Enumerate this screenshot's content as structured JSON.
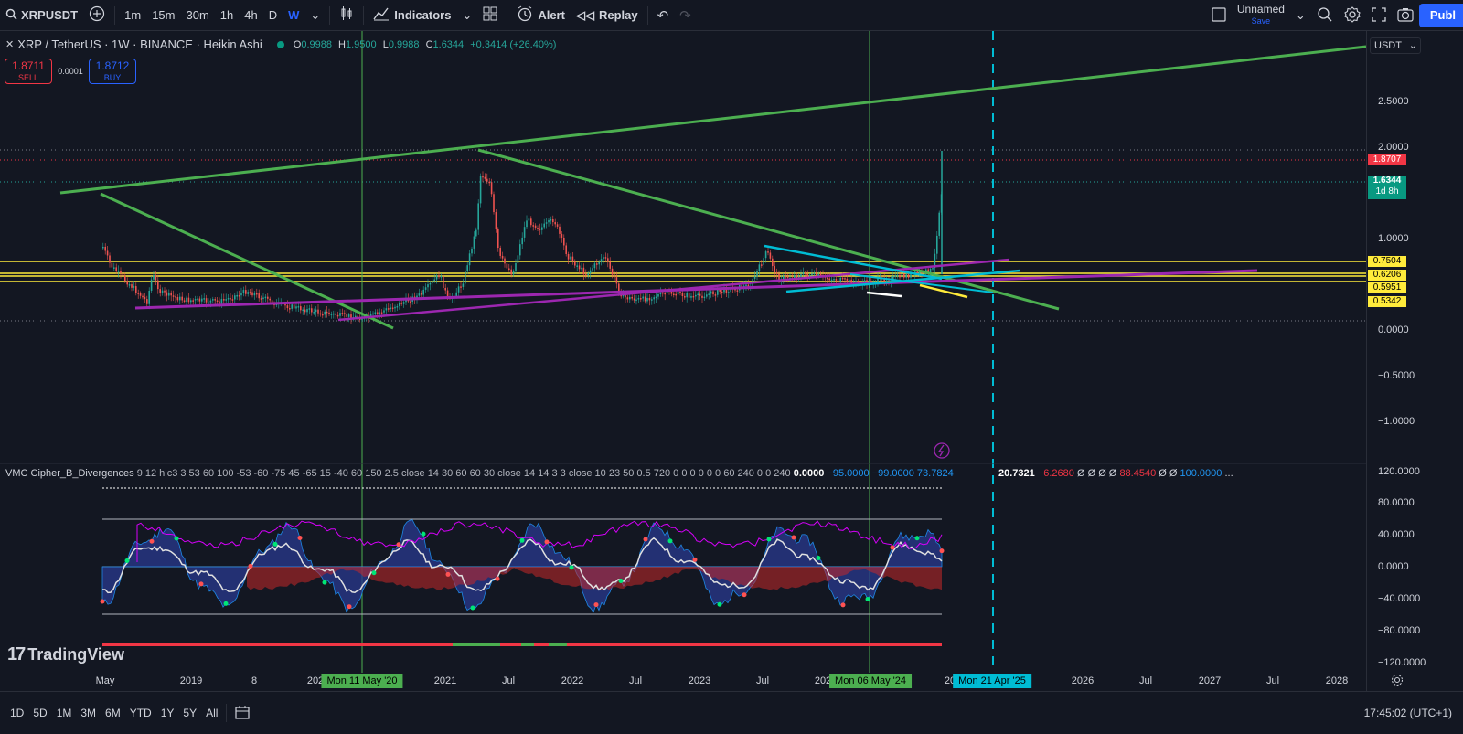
{
  "toolbar": {
    "symbol": "XRPUSDT",
    "intervals": [
      "1m",
      "15m",
      "30m",
      "1h",
      "4h",
      "D",
      "W"
    ],
    "active_interval": "W",
    "indicators_label": "Indicators",
    "alert_label": "Alert",
    "replay_label": "Replay",
    "layout_name": "Unnamed",
    "layout_save": "Save",
    "publish_label": "Publ"
  },
  "legend": {
    "title": "XRP / TetherUS · 1W · BINANCE · Heikin Ashi",
    "open_label": "O",
    "open": "0.9988",
    "high_label": "H",
    "high": "1.9500",
    "low_label": "L",
    "low": "0.9988",
    "close_label": "C",
    "close": "1.6344",
    "change": "+0.3414 (+26.40%)"
  },
  "trade": {
    "sell_price": "1.8711",
    "sell_label": "SELL",
    "spread": "0.0001",
    "buy_price": "1.8712",
    "buy_label": "BUY"
  },
  "indicator": {
    "name": "VMC Cipher_B_Divergences",
    "params": "9 12 hlc3 3 53 60 100 -53 -60 -75 45 -65 15 -40 60 150 2.5 close 14 30 60 60 30 close 14 14 3 3 close 10 23 50 0.5 720 0 0 0 0 0 0 60 240 0 0 240",
    "v1": "0.0000",
    "v2": "−95.0000",
    "v3": "−99.0000",
    "v4": "73.7824",
    "v5": "20.7321",
    "v6": "−6.2680",
    "v7": "Ø Ø Ø Ø",
    "v8": "88.4540",
    "v9": "Ø Ø",
    "v10": "100.0000",
    "v11": "..."
  },
  "price_axis": {
    "currency": "USDT",
    "labels": [
      "2.5000",
      "2.0000",
      "1.0000",
      "0.0000",
      "−0.5000",
      "−1.0000"
    ],
    "tags": {
      "last_red": "1.8707",
      "current": "1.6344",
      "countdown": "1d 8h",
      "levels": [
        "0.7504",
        "0.6206",
        "0.5951",
        "0.5342"
      ]
    },
    "osc_labels": [
      "120.0000",
      "80.0000",
      "40.0000",
      "0.0000",
      "−40.0000",
      "−80.0000",
      "−120.0000"
    ]
  },
  "time_axis": {
    "labels": [
      "May",
      "2019",
      "8",
      "202",
      "2021",
      "Jul",
      "2022",
      "Jul",
      "2023",
      "Jul",
      "202",
      "20",
      "2026",
      "Jul",
      "2027",
      "Jul",
      "2028"
    ],
    "tag1": "Mon 11 May '20",
    "tag2": "Mon 06 May '24",
    "tag3": "Mon 21 Apr '25"
  },
  "bottom": {
    "ranges": [
      "1D",
      "5D",
      "1M",
      "3M",
      "6M",
      "YTD",
      "1Y",
      "5Y",
      "All"
    ],
    "clock": "17:45:02 (UTC+1)"
  },
  "brand": "TradingView",
  "colors": {
    "background": "#131722",
    "up": "#26a69a",
    "down": "#ef5350",
    "trendline_green": "#4caf50",
    "trendline_purple": "#9c27b0",
    "level_yellow": "#ffeb3b",
    "cyan": "#00bcd4",
    "accent": "#2962ff"
  },
  "icons": [
    "search-icon",
    "add-symbol-icon",
    "bar-style-icon",
    "indicators-icon",
    "templates-icon",
    "alert-icon",
    "replay-icon",
    "undo-icon",
    "redo-icon",
    "layout-icon",
    "quick-search-icon",
    "settings-icon",
    "fullscreen-icon",
    "snapshot-icon",
    "date-range-icon"
  ]
}
